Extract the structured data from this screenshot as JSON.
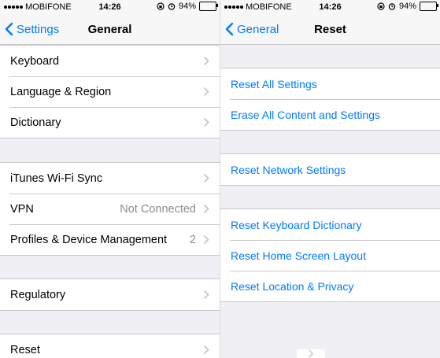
{
  "left": {
    "status": {
      "carrier": "MOBIFONE",
      "time": "14:26",
      "battery": "94%"
    },
    "nav": {
      "back_label": "Settings",
      "title": "General"
    },
    "groups": [
      {
        "rows": [
          {
            "label": "Keyboard"
          },
          {
            "label": "Language & Region"
          },
          {
            "label": "Dictionary"
          }
        ]
      },
      {
        "rows": [
          {
            "label": "iTunes Wi-Fi Sync"
          },
          {
            "label": "VPN",
            "detail": "Not Connected"
          },
          {
            "label": "Profiles & Device Management",
            "detail": "2"
          }
        ]
      },
      {
        "rows": [
          {
            "label": "Regulatory"
          }
        ]
      },
      {
        "rows": [
          {
            "label": "Reset"
          }
        ]
      }
    ]
  },
  "right": {
    "status": {
      "carrier": "MOBIFONE",
      "time": "14:26",
      "battery": "94%"
    },
    "nav": {
      "back_label": "General",
      "title": "Reset"
    },
    "groups": [
      {
        "rows": [
          {
            "label": "Reset All Settings"
          },
          {
            "label": "Erase All Content and Settings"
          }
        ]
      },
      {
        "rows": [
          {
            "label": "Reset Network Settings"
          }
        ]
      },
      {
        "rows": [
          {
            "label": "Reset Keyboard Dictionary"
          },
          {
            "label": "Reset Home Screen Layout"
          },
          {
            "label": "Reset Location & Privacy"
          }
        ]
      }
    ]
  },
  "colors": {
    "accent": "#007aff",
    "background": "#efeff4",
    "separator": "#c8c7cc",
    "detail": "#8e8e93"
  },
  "icons": {
    "back": "chevron-left-icon",
    "disclosure": "chevron-right-icon",
    "alarm": "alarm-icon",
    "rotation_lock": "rotation-lock-icon",
    "battery": "battery-icon"
  },
  "battery_level": 0.94
}
